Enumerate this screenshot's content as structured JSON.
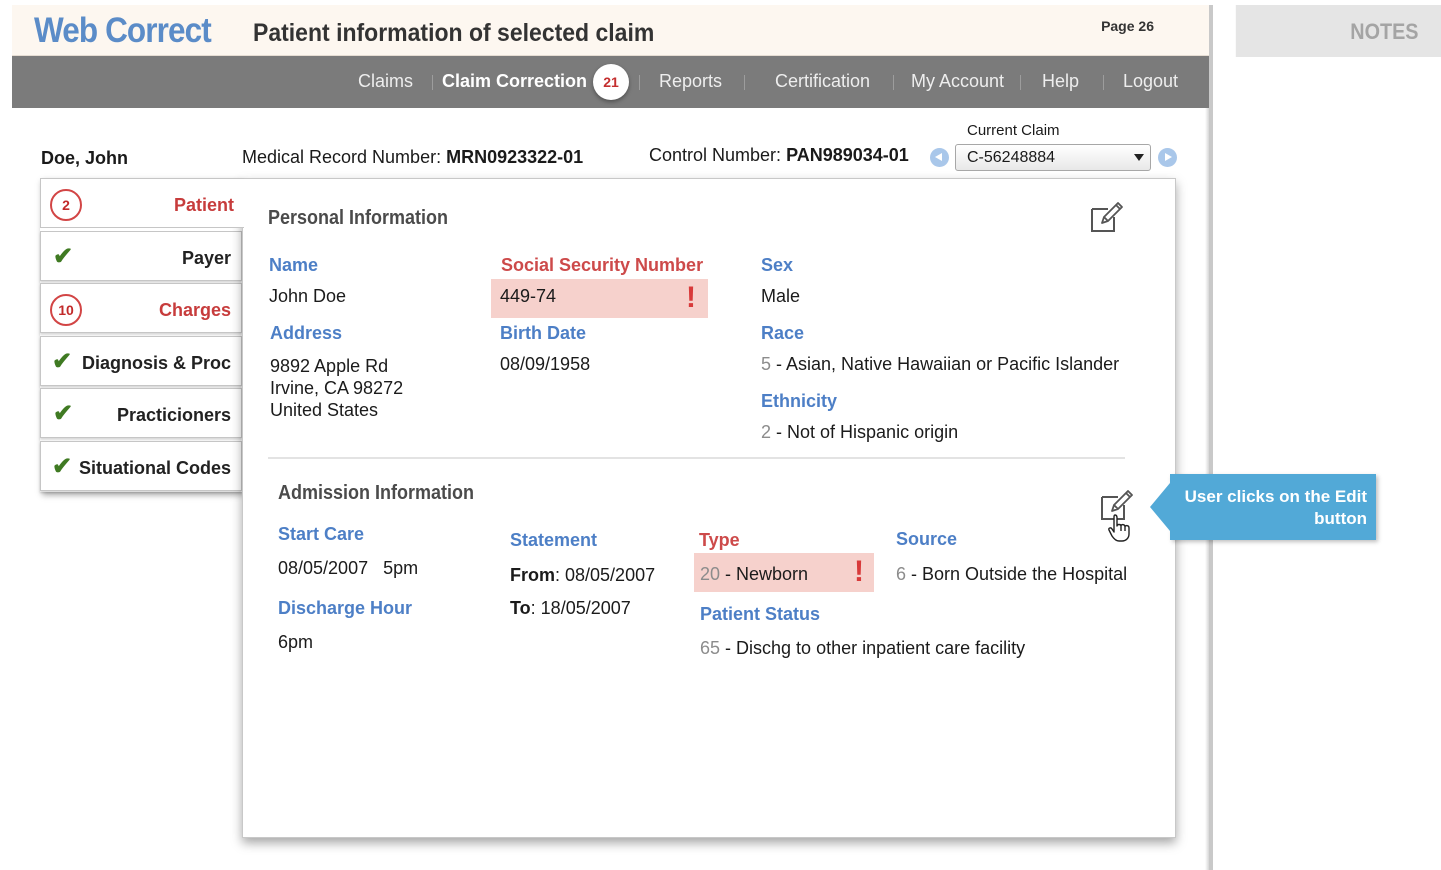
{
  "app": {
    "name": "Web Correct",
    "title": "Patient information of selected claim",
    "page": "Page 26"
  },
  "notes": {
    "title": "NOTES"
  },
  "nav": {
    "items": [
      {
        "label": "Claims"
      },
      {
        "label": "Claim Correction"
      },
      {
        "label": "Reports"
      },
      {
        "label": "Certification"
      },
      {
        "label": "My Account"
      },
      {
        "label": "Help"
      },
      {
        "label": "Logout"
      }
    ],
    "correction_count": "21"
  },
  "patient": {
    "name": "Doe, John",
    "mrn_label": "Medical Record Number:",
    "mrn": "MRN0923322-01",
    "control_label": "Control Number:",
    "control": "PAN989034-01"
  },
  "claim": {
    "label": "Current Claim",
    "value": "C-56248884"
  },
  "tabs": [
    {
      "label": "Patient",
      "badge": "2",
      "status": "error"
    },
    {
      "label": "Payer",
      "status": "ok"
    },
    {
      "label": "Charges",
      "badge": "10",
      "status": "error"
    },
    {
      "label": "Diagnosis & Proc",
      "status": "ok"
    },
    {
      "label": "Practicioners",
      "status": "ok"
    },
    {
      "label": "Situational Codes",
      "status": "ok"
    }
  ],
  "personal": {
    "title": "Personal Information",
    "name_label": "Name",
    "name": "John Doe",
    "ssn_label": "Social Security Number",
    "ssn": "449-74",
    "sex_label": "Sex",
    "sex": "Male",
    "address_label": "Address",
    "address": [
      "9892 Apple Rd",
      "Irvine, CA 98272",
      "United States"
    ],
    "birth_label": "Birth Date",
    "birth": "08/09/1958",
    "race_label": "Race",
    "race_code": "5",
    "race": "Asian, Native Hawaiian or Pacific Islander",
    "ethnicity_label": "Ethnicity",
    "ethnicity_code": "2",
    "ethnicity": "Not of Hispanic origin"
  },
  "admission": {
    "title": "Admission Information",
    "start_label": "Start Care",
    "start_date": "08/05/2007",
    "start_time": "5pm",
    "discharge_label": "Discharge Hour",
    "discharge": "6pm",
    "statement_label": "Statement",
    "from_label": "From",
    "from": "08/05/2007",
    "to_label": "To",
    "to": "18/05/2007",
    "type_label": "Type",
    "type_code": "20",
    "type": "Newborn",
    "status_label": "Patient Status",
    "status_code": "65",
    "status": "Dischg to other inpatient care facility",
    "source_label": "Source",
    "source_code": "6",
    "source": "Born Outside the Hospital"
  },
  "callout": {
    "line1": "User clicks on the Edit",
    "line2": "button"
  },
  "colors": {
    "accent": "#4d7fc6",
    "error": "#cd4a4a",
    "error_bg": "#f6d1cc",
    "ok": "#3f7a22",
    "nav": "#7b7b7b",
    "callout": "#52a9d7"
  },
  "icons": {
    "edit": "edit-icon",
    "cursor": "hand-pointer-icon",
    "check": "check-icon"
  }
}
